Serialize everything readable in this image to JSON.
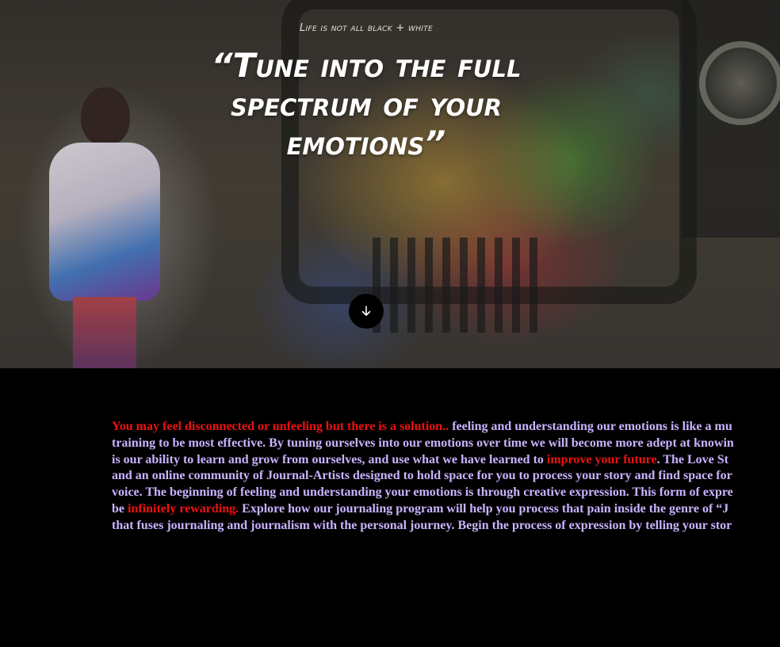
{
  "hero": {
    "eyebrow": "Life is not all black + white",
    "headline": "“Tune into the full spectrum of your emotions”",
    "scroll_icon": "arrow-down-icon"
  },
  "content": {
    "paragraph": [
      {
        "text": "You may feel disconnected or unfeeling but there is a solution.. ",
        "highlight": true
      },
      {
        "text": "feeling and understanding our emotions is like a mu",
        "highlight": false
      },
      {
        "text": "training to be most effective. By tuning ourselves into our emotions over time we will become more adept at knowin",
        "highlight": false
      },
      {
        "text": "is our ability to learn and grow from ourselves, and use what we have learned to ",
        "highlight": false
      },
      {
        "text": "improve your future",
        "highlight": true
      },
      {
        "text": ". The Love St",
        "highlight": false
      },
      {
        "text": "and an online community of Journal-Artists designed to hold space for you to process your story and find space for",
        "highlight": false
      },
      {
        "text": "voice. The beginning of feeling and understanding your emotions is through creative expression. This form of expre",
        "highlight": false
      },
      {
        "text": "be ",
        "highlight": false
      },
      {
        "text": "infinitely rewarding.",
        "highlight": true
      },
      {
        "text": " Explore how our journaling program will help you process that pain inside the genre of “J",
        "highlight": false
      },
      {
        "text": "that fuses journaling and journalism with the personal journey. Begin the process of expression by telling your stor",
        "highlight": false
      }
    ]
  },
  "colors": {
    "body_text": "#c9b3ff",
    "highlight_text": "#ee1111",
    "background": "#000000"
  }
}
